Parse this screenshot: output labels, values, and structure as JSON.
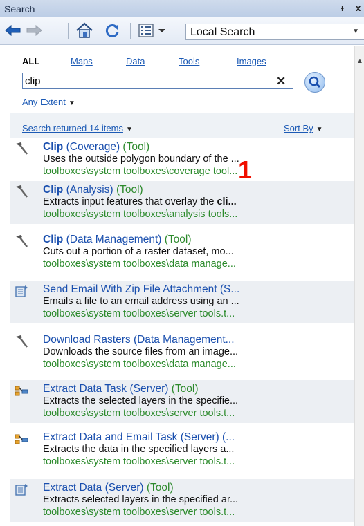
{
  "window": {
    "title": "Search",
    "pin_glyph": "ᵻ",
    "close_glyph": "x"
  },
  "toolbar": {
    "back_icon": "back-arrow-icon",
    "forward_icon": "forward-arrow-icon",
    "home_icon": "home-icon",
    "refresh_icon": "refresh-icon",
    "view_icon": "list-view-icon",
    "location_value": "Local Search"
  },
  "search": {
    "tabs": [
      {
        "label": "ALL",
        "active": true
      },
      {
        "label": "Maps",
        "active": false
      },
      {
        "label": "Data",
        "active": false
      },
      {
        "label": "Tools",
        "active": false
      },
      {
        "label": "Images",
        "active": false
      }
    ],
    "query": "clip",
    "clear_glyph": "✕",
    "extent_label": "Any Extent",
    "results_label": "Search returned 14 items",
    "sort_label": "Sort By"
  },
  "results": [
    {
      "icon": "hammer-tool-icon",
      "name": "Clip",
      "rest": " (Coverage)",
      "tag": " (Tool)",
      "desc": "Uses the outside polygon boundary of the ...",
      "path": "toolboxes\\system toolboxes\\coverage tool..."
    },
    {
      "icon": "hammer-tool-icon",
      "name": "Clip",
      "rest": " (Analysis)",
      "tag": " (Tool)",
      "desc_pre": "Extracts input features that overlay the ",
      "desc_bold": "cli...",
      "path": "toolboxes\\system toolboxes\\analysis tools..."
    },
    {
      "icon": "hammer-tool-icon",
      "name": "Clip",
      "rest": " (Data Management)",
      "tag": " (Tool)",
      "desc": "Cuts out a portion of a raster dataset, mo...",
      "path": "toolboxes\\system toolboxes\\data manage..."
    },
    {
      "icon": "script-tool-icon",
      "name": "Send Email With Zip File Attachment (S...",
      "desc": "Emails a file to an email address using an ...",
      "path": "toolboxes\\system toolboxes\\server tools.t..."
    },
    {
      "icon": "hammer-tool-icon",
      "name": "Download Rasters (Data Management...",
      "desc": "Downloads the source files from an image...",
      "path": "toolboxes\\system toolboxes\\data manage..."
    },
    {
      "icon": "model-tool-icon",
      "name": "Extract Data Task (Server)",
      "tag": " (Tool)",
      "desc": "Extracts the selected layers in the specifie...",
      "path": "toolboxes\\system toolboxes\\server tools.t..."
    },
    {
      "icon": "model-tool-icon",
      "name": "Extract Data and Email Task (Server) (...",
      "desc": "Extracts the data in the specified layers a...",
      "path": "toolboxes\\system toolboxes\\server tools.t..."
    },
    {
      "icon": "script-tool-icon",
      "name": "Extract Data (Server)",
      "tag": " (Tool)",
      "desc": "Extracts selected layers in the specified ar...",
      "path": "toolboxes\\system toolboxes\\server tools.t..."
    }
  ],
  "annotation": "1",
  "colors": {
    "link": "#1a4fae",
    "path_green": "#2b8a2b",
    "annotation_red": "#f00f00"
  }
}
